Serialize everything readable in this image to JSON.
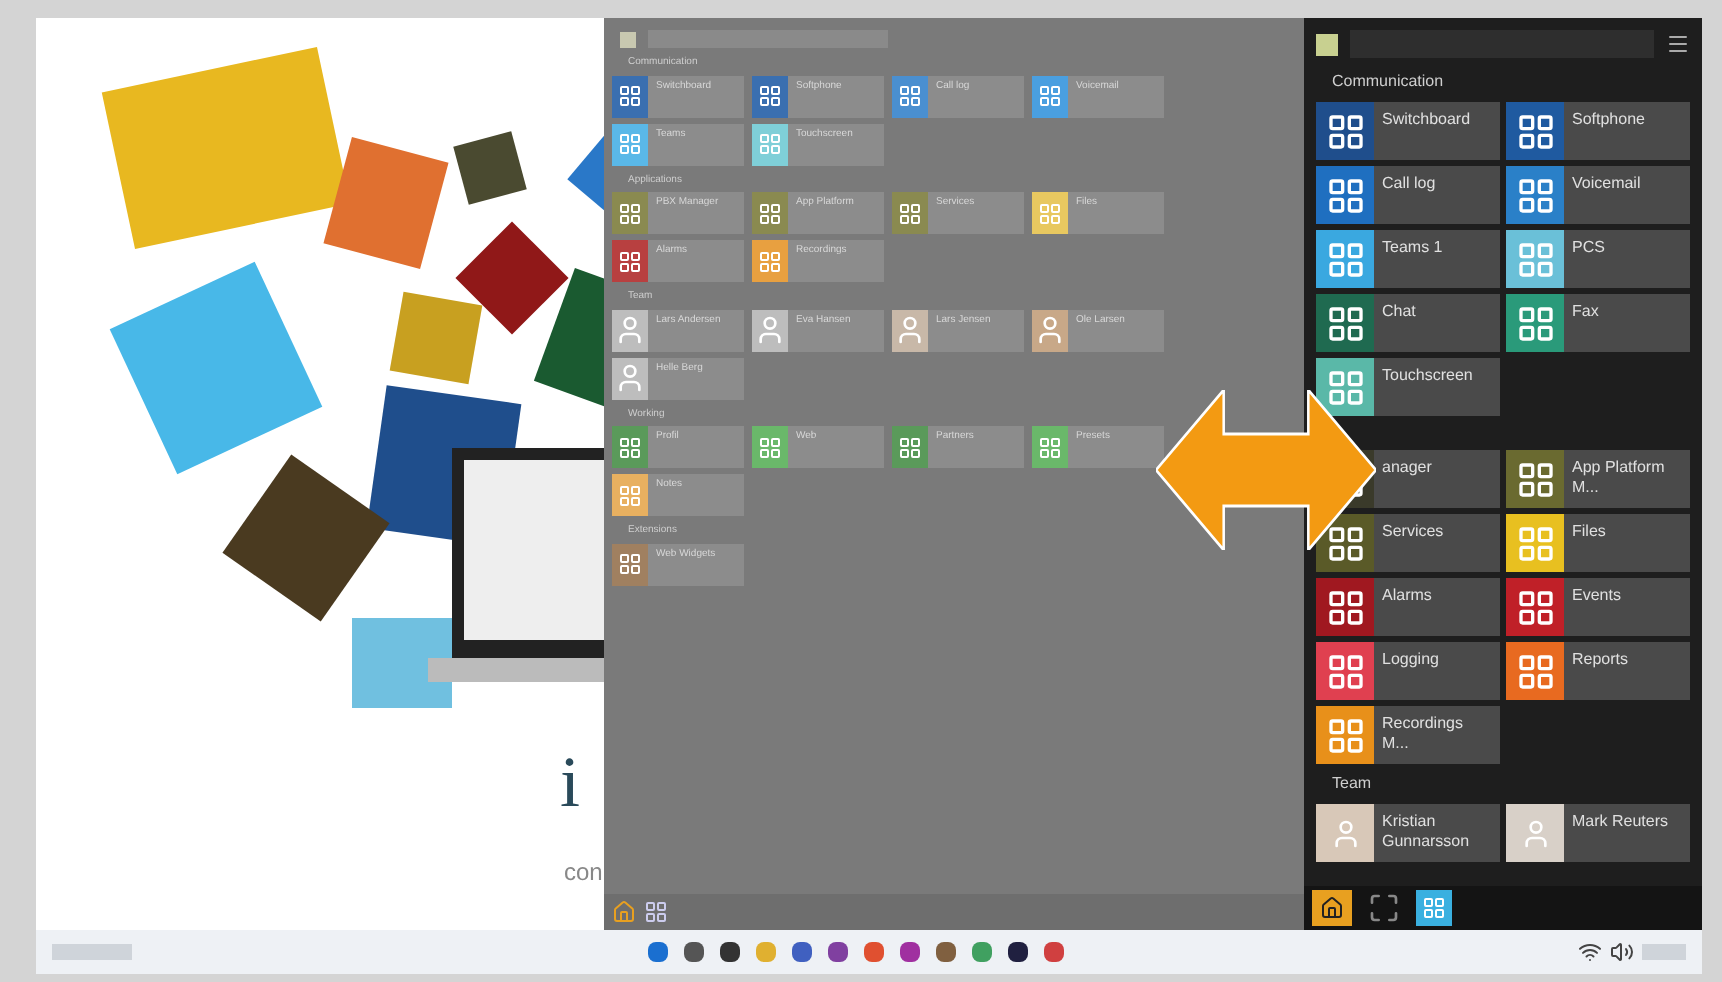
{
  "illustration": {
    "heading": "i",
    "subheading": "con"
  },
  "gray_panel": {
    "sections": [
      {
        "title": "Communication",
        "tiles": [
          {
            "label": "Switchboard",
            "kind": "app",
            "color": "#3a6fb0"
          },
          {
            "label": "Softphone",
            "kind": "app",
            "color": "#3a6fb0"
          },
          {
            "label": "Call log",
            "kind": "app",
            "color": "#4a8fd0"
          },
          {
            "label": "Voicemail",
            "kind": "app",
            "color": "#4a9fe0"
          },
          {
            "label": "Teams",
            "kind": "app",
            "color": "#5ab8e8"
          },
          {
            "label": "Touchscreen",
            "kind": "app",
            "color": "#7fcfd8"
          }
        ]
      },
      {
        "title": "Applications",
        "tiles": [
          {
            "label": "PBX Manager",
            "kind": "app",
            "color": "#8a8a50"
          },
          {
            "label": "App Platform",
            "kind": "app",
            "color": "#8a8a50"
          },
          {
            "label": "Services",
            "kind": "app",
            "color": "#8a8a50"
          },
          {
            "label": "Files",
            "kind": "app",
            "color": "#e8c860"
          },
          {
            "label": "Alarms",
            "kind": "app",
            "color": "#b84040"
          },
          {
            "label": "Recordings",
            "kind": "app",
            "color": "#e8a040"
          }
        ]
      },
      {
        "title": "Team",
        "tiles": [
          {
            "label": "Lars Andersen",
            "kind": "person",
            "color": "#bdbdbd"
          },
          {
            "label": "Eva Hansen",
            "kind": "person",
            "color": "#bdbdbd"
          },
          {
            "label": "Lars Jensen",
            "kind": "person",
            "color": "#c8b8a8"
          },
          {
            "label": "Ole Larsen",
            "kind": "person",
            "color": "#c8a888"
          },
          {
            "label": "Helle Berg",
            "kind": "person",
            "color": "#bdbdbd"
          }
        ]
      },
      {
        "title": "Working",
        "tiles": [
          {
            "label": "Profil",
            "kind": "app",
            "color": "#5a9a5a"
          },
          {
            "label": "Web",
            "kind": "app",
            "color": "#6ab86a"
          },
          {
            "label": "Partners",
            "kind": "app",
            "color": "#5a9a5a"
          },
          {
            "label": "Presets",
            "kind": "app",
            "color": "#6ab86a"
          },
          {
            "label": "Notes",
            "kind": "app",
            "color": "#e8b060"
          }
        ]
      },
      {
        "title": "Extensions",
        "tiles": [
          {
            "label": "Web Widgets",
            "kind": "app",
            "color": "#a08060"
          }
        ]
      }
    ]
  },
  "dark_panel": {
    "sections": [
      {
        "title": "Communication",
        "tiles": [
          {
            "label": "Switchboard",
            "kind": "app",
            "color": "#1f4e8c"
          },
          {
            "label": "Softphone",
            "kind": "app",
            "color": "#1f5aa0"
          },
          {
            "label": "Call log",
            "kind": "app",
            "color": "#1f6fc0"
          },
          {
            "label": "Voicemail",
            "kind": "app",
            "color": "#2a80c8"
          },
          {
            "label": "Teams 1",
            "kind": "app",
            "color": "#3aa8e0"
          },
          {
            "label": "PCS",
            "kind": "app",
            "color": "#6ac0d8"
          },
          {
            "label": "Chat",
            "kind": "app",
            "color": "#1f6a50"
          },
          {
            "label": "Fax",
            "kind": "app",
            "color": "#2a9a7a"
          },
          {
            "label": "Touchscreen",
            "kind": "app",
            "color": "#5ab8a8"
          }
        ]
      },
      {
        "tiles": [
          {
            "label": "anager",
            "kind": "app"
          },
          {
            "label": "App Platform M...",
            "kind": "app",
            "color": "#6a6a30"
          },
          {
            "label": "Services",
            "kind": "app",
            "color": "#5a5a28"
          },
          {
            "label": "Files",
            "kind": "app",
            "color": "#e8c020"
          },
          {
            "label": "Alarms",
            "kind": "app",
            "color": "#a01820"
          },
          {
            "label": "Events",
            "kind": "app",
            "color": "#c02028"
          },
          {
            "label": "Logging",
            "kind": "app",
            "color": "#e04050"
          },
          {
            "label": "Reports",
            "kind": "app",
            "color": "#e86a20"
          },
          {
            "label": "Recordings M...",
            "kind": "app",
            "color": "#e8901a"
          }
        ]
      },
      {
        "title": "Team",
        "tiles": [
          {
            "label": "Kristian Gunnarsson",
            "kind": "person",
            "color": "#d8c8b8"
          },
          {
            "label": "Mark Reuters",
            "kind": "person",
            "color": "#d8d0c8"
          }
        ]
      }
    ]
  }
}
